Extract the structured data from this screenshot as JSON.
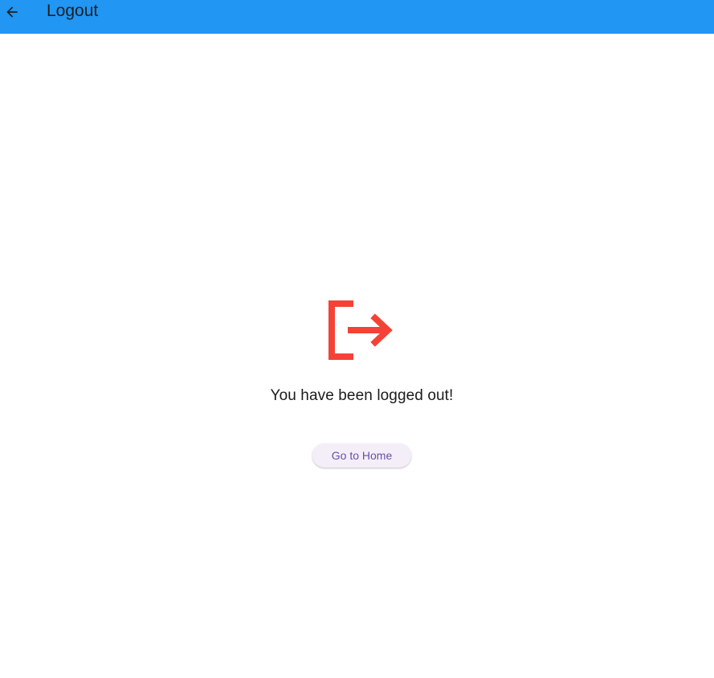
{
  "appbar": {
    "title": "Logout",
    "back_icon": "arrow-back-icon",
    "color": "#2196f3"
  },
  "main": {
    "icon": "logout-icon",
    "icon_color": "#f44336",
    "message": "You have been logged out!",
    "home_button_label": "Go to Home",
    "button_text_color": "#6750a4"
  }
}
